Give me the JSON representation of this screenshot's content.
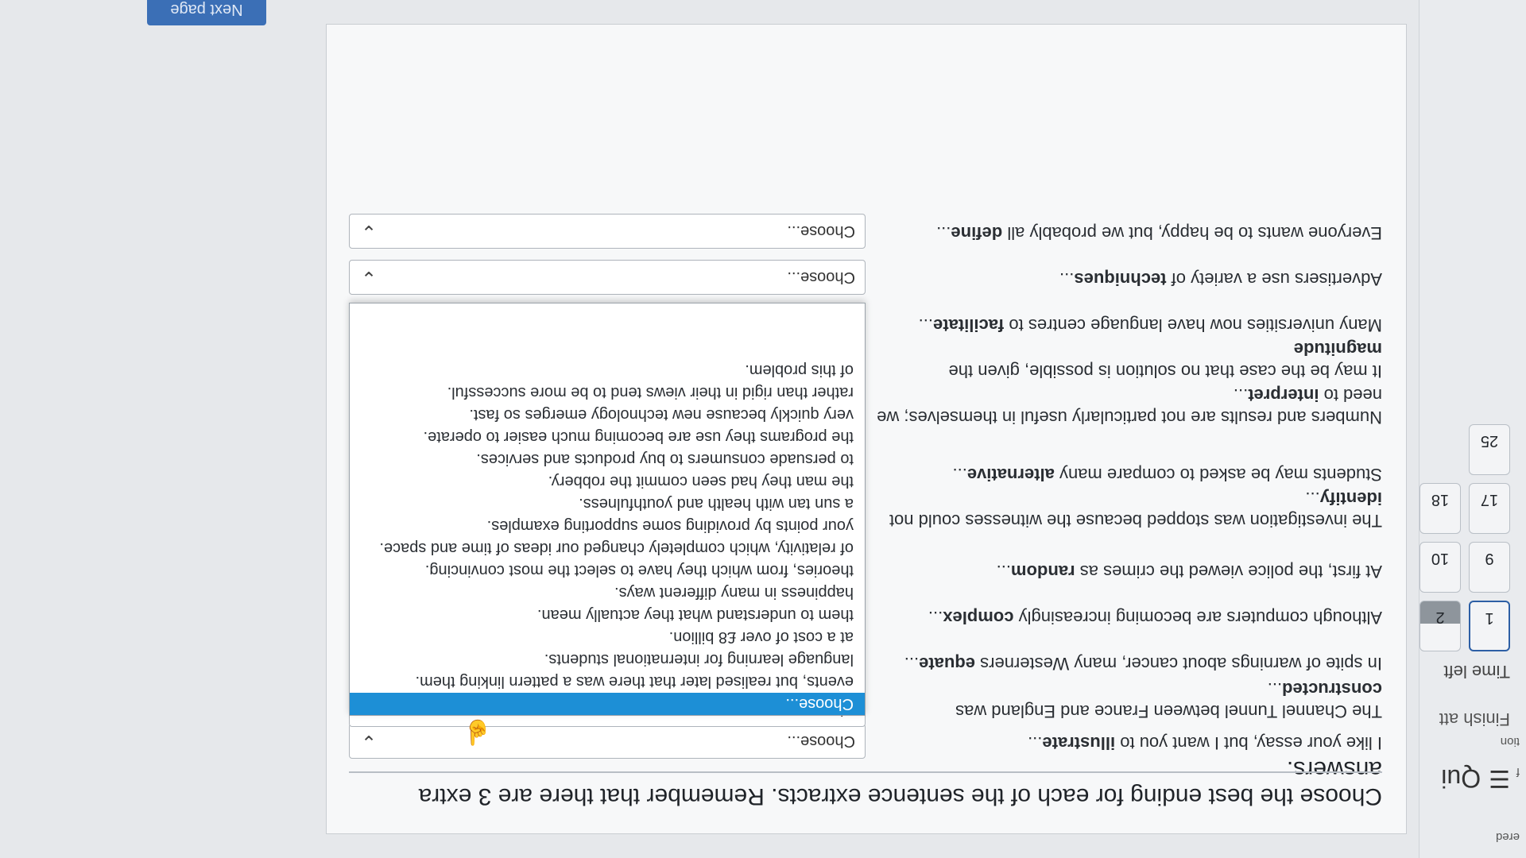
{
  "leftnav": {
    "fragment_top": "ered",
    "fragment_mid": "f",
    "fragment_low": "tion",
    "menu_icon": "hamburger-icon",
    "menu_title": "Qui",
    "finish_label": "Finish att",
    "time_left_label": "Time left",
    "question_buttons": [
      {
        "label": "1",
        "state": "current"
      },
      {
        "label": "2",
        "state": "answered"
      },
      {
        "label": "",
        "state": "empty"
      },
      {
        "label": "9",
        "state": "normal"
      },
      {
        "label": "10",
        "state": "normal"
      },
      {
        "label": "",
        "state": "empty"
      },
      {
        "label": "17",
        "state": "normal"
      },
      {
        "label": "18",
        "state": "normal"
      },
      {
        "label": "",
        "state": "empty"
      },
      {
        "label": "25",
        "state": "normal"
      }
    ]
  },
  "instruction": "Choose the best ending for each of the sentence extracts. Remember that there are 3 extra answers.",
  "questions": [
    {
      "prefix": "I like your essay, but I want you to ",
      "bold": "illustrate",
      "suffix": "...",
      "selected": "Choose..."
    },
    {
      "prefix": "The Channel Tunnel between France and England was ",
      "bold": "constructed",
      "suffix": "...",
      "selected": "Choose..."
    },
    {
      "prefix": "In spite of warnings about cancer, many Westerners ",
      "bold": "equate",
      "suffix": "...",
      "selected": "Choose..."
    },
    {
      "prefix": "Although computers are becoming increasingly ",
      "bold": "complex",
      "suffix": "...",
      "selected": "Choose..."
    },
    {
      "prefix": "At first, the police viewed the crimes as ",
      "bold": "random",
      "suffix": "...",
      "selected": "Choose..."
    },
    {
      "prefix": "The investigation was stopped because the witnesses could not ",
      "bold": "identify",
      "suffix": "...",
      "selected": "Choose..."
    },
    {
      "prefix": "Students may be asked to compare many ",
      "bold": "alternative",
      "suffix": "...",
      "selected": "Choose..."
    },
    {
      "prefix": "Numbers and results are not particularly useful in themselves; we need to ",
      "bold": "interpret",
      "suffix": "...",
      "selected": "Choose..."
    },
    {
      "prefix": "It may be the case that no solution is possible, given the ",
      "bold": "magnitude",
      "suffix": "",
      "selected": "Choose..."
    },
    {
      "prefix": "Many universities now have language centres to ",
      "bold": "facilitate",
      "suffix": "...",
      "selected": "Choose..."
    },
    {
      "prefix": "Advertisers use a variety of ",
      "bold": "techniques",
      "suffix": "...",
      "selected": "Choose..."
    },
    {
      "prefix": "Everyone wants to be happy, but we probably all ",
      "bold": "define",
      "suffix": "...",
      "selected": "Choose..."
    }
  ],
  "dropdown_options": [
    "Choose...",
    "events, but realised later that there was a pattern linking them.",
    "language learning for international students.",
    "at a cost of over £8 billion.",
    "them to understand what they actually mean.",
    "happiness in many different ways.",
    "theories, from which they have to select the most convincing.",
    "of relativity, which completely changed our ideas of time and space.",
    "your points by providing some supporting examples.",
    "a sun tan with health and youthfulness.",
    "the man they had seen commit the robbery.",
    "to persuade consumers to buy products and services.",
    "the programs they use are becoming much easier to operate.",
    "very quickly because new technology emerges so fast.",
    "rather than rigid in their views tend to be more successful.",
    "of this problem."
  ],
  "dropdown_selected_index": 0,
  "next_button": "Next page",
  "colors": {
    "selected_option": "#1d8fd6",
    "button": "#3b6fb6"
  }
}
